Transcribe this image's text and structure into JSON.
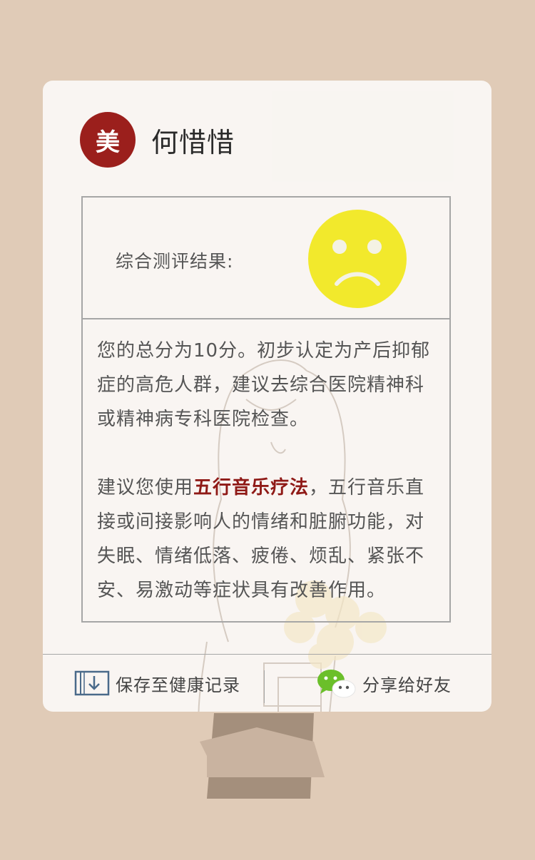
{
  "user": {
    "avatar_char": "美",
    "name": "何惜惜"
  },
  "result": {
    "label": "综合测评结果:",
    "mood_icon": "sad-face-icon",
    "paragraph1": "您的总分为10分。初步认定为产后抑郁症的高危人群，建议去综合医院精神科或精神病专科医院检查。",
    "paragraph2_prefix": "建议您使用",
    "paragraph2_highlight": "五行音乐疗法",
    "paragraph2_suffix": "，五行音乐直接或间接影响人的情绪和脏腑功能，对失眠、情绪低落、疲倦、烦乱、紧张不安、易激动等症状具有改善作用。"
  },
  "footer": {
    "save_label": "保存至健康记录",
    "share_label": "分享给好友"
  },
  "colors": {
    "background": "#e0cbb7",
    "accent": "#9b1f1c",
    "highlight": "#8f1a17",
    "face": "#f2e92c",
    "wechat": "#6bbf2a"
  }
}
